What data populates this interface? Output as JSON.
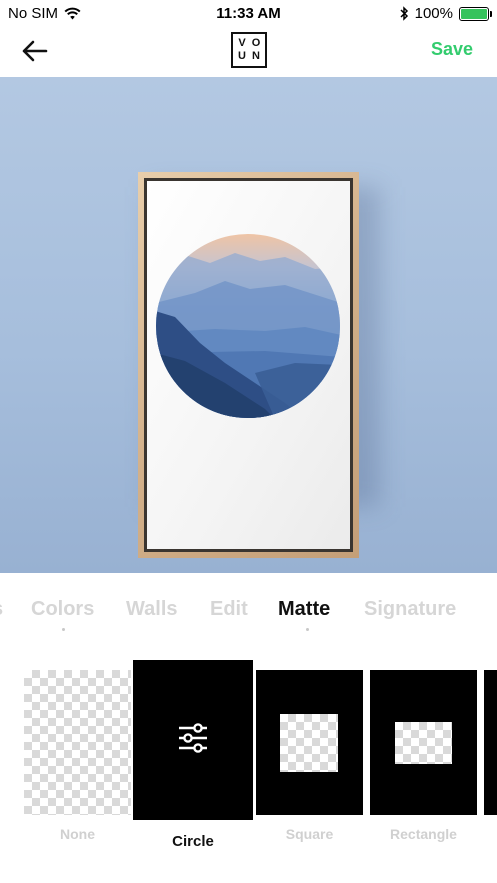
{
  "status_bar": {
    "carrier": "No SIM",
    "time": "11:33 AM",
    "battery_percent": "100%",
    "battery_level": 1.0
  },
  "nav": {
    "logo_letters": [
      "V",
      "O",
      "U",
      "N"
    ],
    "save_label": "Save",
    "accent_color": "#33cc6e"
  },
  "tabs": {
    "items": [
      {
        "label": "Colors",
        "active": false
      },
      {
        "label": "Walls",
        "active": false
      },
      {
        "label": "Edit",
        "active": false
      },
      {
        "label": "Matte",
        "active": true
      },
      {
        "label": "Signature",
        "active": false
      }
    ]
  },
  "options": {
    "items": [
      {
        "label": "None",
        "selected": false
      },
      {
        "label": "Circle",
        "selected": true,
        "icon": "sliders-icon"
      },
      {
        "label": "Square",
        "selected": false
      },
      {
        "label": "Rectangle",
        "selected": false
      }
    ]
  }
}
